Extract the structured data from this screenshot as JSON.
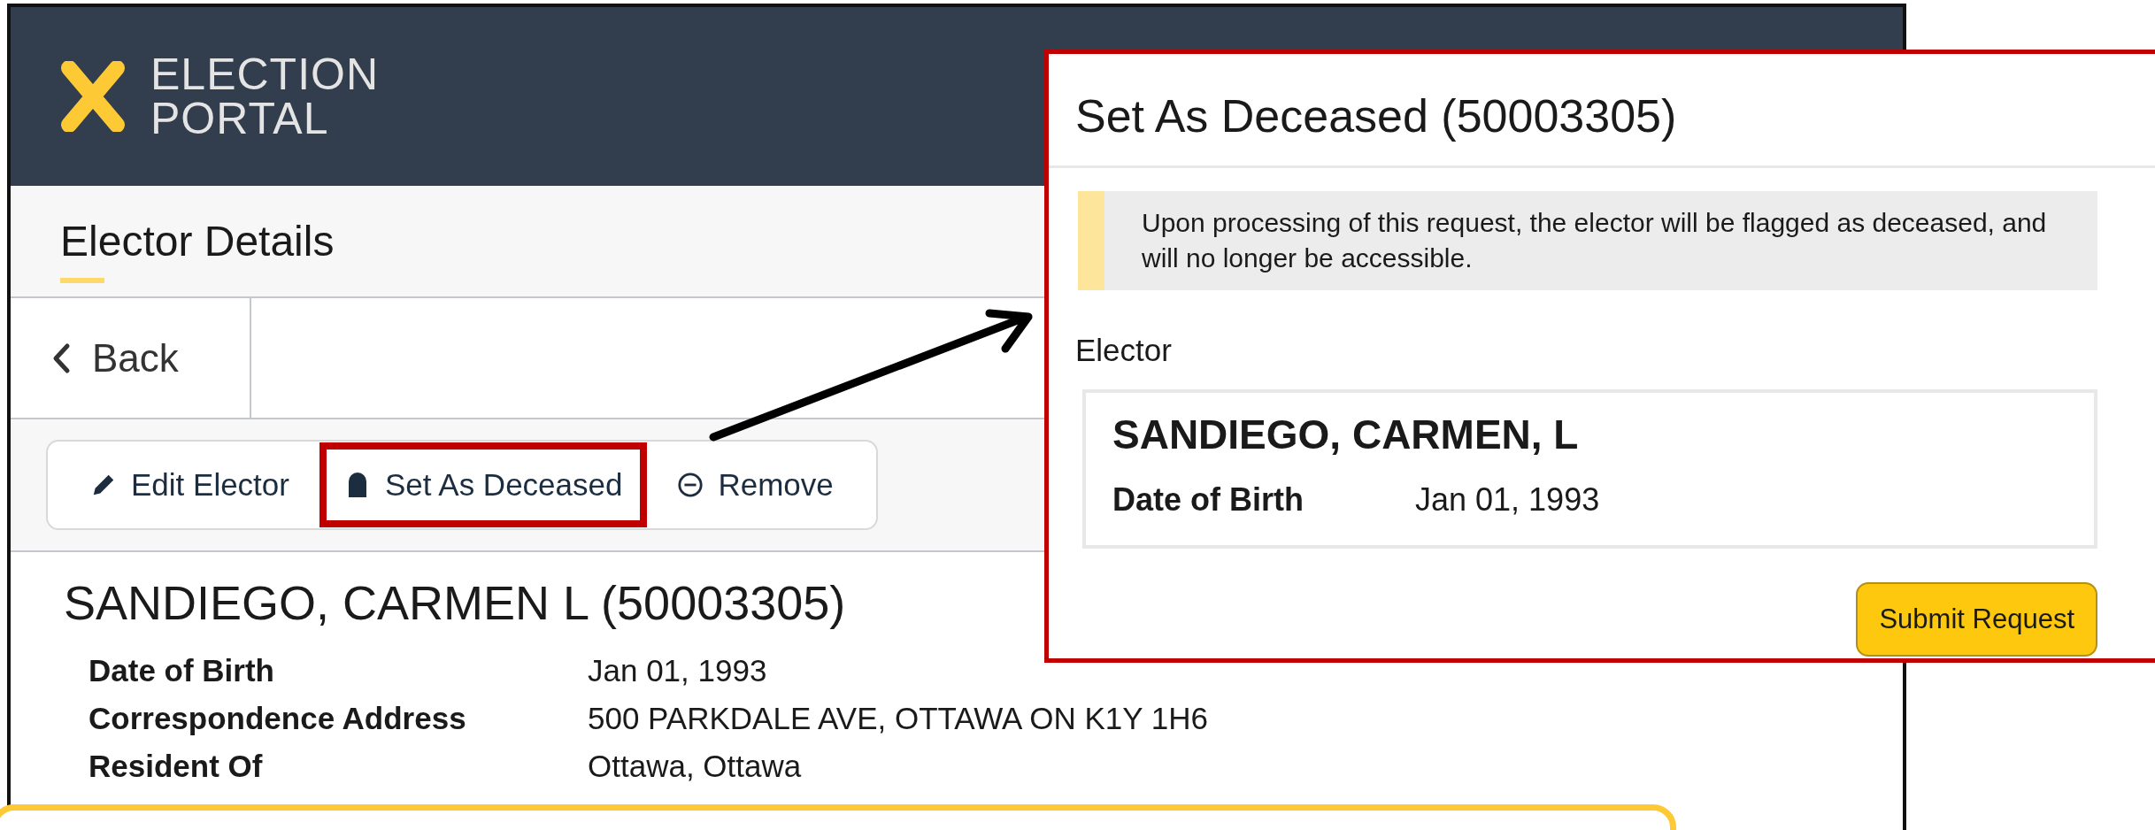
{
  "header": {
    "logo_line_1": "ELECTION",
    "logo_line_2": "PORTAL"
  },
  "page_title": "Elector Details",
  "back": {
    "label": "Back"
  },
  "toolbar": [
    {
      "kind": "edit",
      "label": "Edit Elector",
      "highlighted": false
    },
    {
      "kind": "deceased",
      "label": "Set As Deceased",
      "highlighted": true
    },
    {
      "kind": "remove",
      "label": "Remove",
      "highlighted": false
    }
  ],
  "elector": {
    "name": "SANDIEGO, CARMEN L (50003305)",
    "details": [
      {
        "label": "Date of Birth",
        "value": "Jan 01, 1993"
      },
      {
        "label": "Correspondence Address",
        "value": "500 PARKDALE AVE, OTTAWA ON K1Y 1H6"
      },
      {
        "label": "Resident Of",
        "value": "Ottawa, Ottawa"
      }
    ]
  },
  "dialog": {
    "title": "Set As Deceased (50003305)",
    "notice": "Upon processing of this request, the elector will be flagged as deceased, and will no longer be accessible.",
    "section_label": "Elector",
    "card": {
      "name": "SANDIEGO, CARMEN, L",
      "dob_label": "Date of Birth",
      "dob_value": "Jan 01, 1993"
    },
    "submit": "Submit Request"
  }
}
